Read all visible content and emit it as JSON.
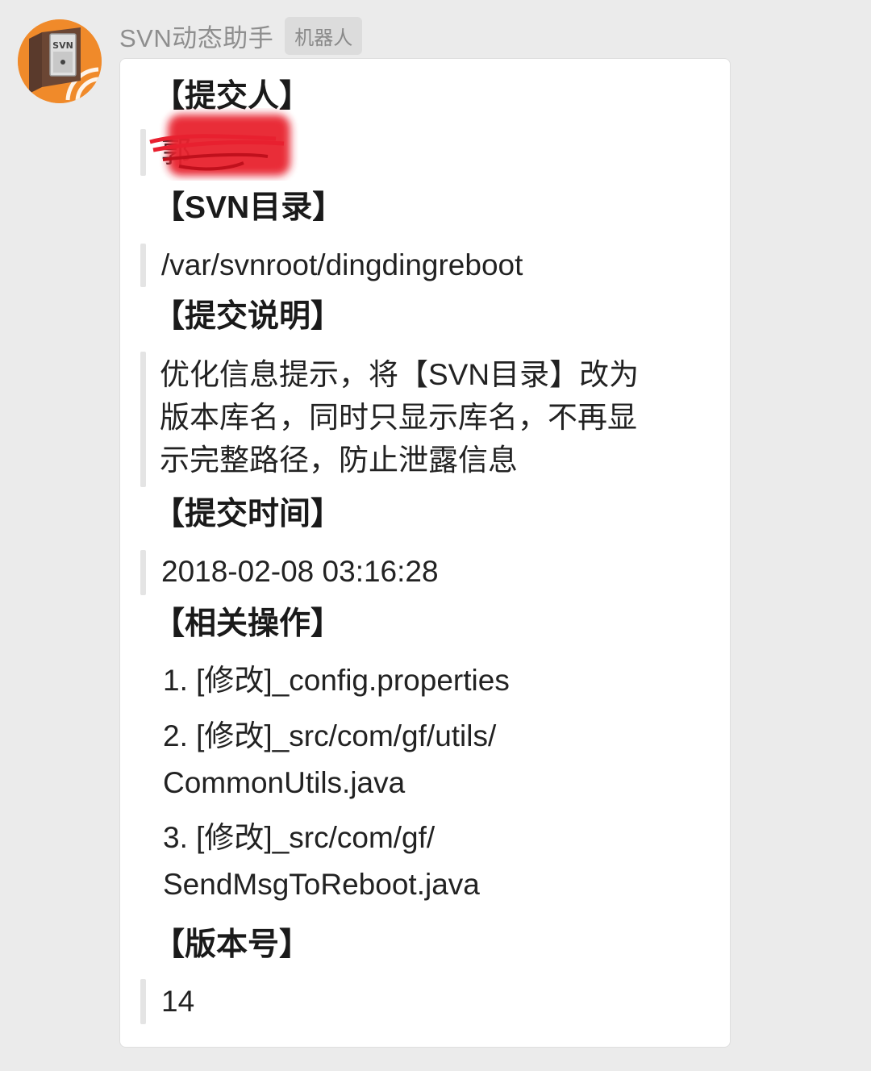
{
  "sender": {
    "name": "SVN动态助手",
    "badge": "机器人",
    "avatar_icon": "svn-box-icon"
  },
  "message": {
    "committer": {
      "heading": "【提交人】",
      "value": "郭"
    },
    "svn_dir": {
      "heading": "【SVN目录】",
      "value": "/var/svnroot/dingdingreboot"
    },
    "commit_desc": {
      "heading": "【提交说明】",
      "lines": [
        "优化信息提示，将【SVN目录】改为",
        "版本库名，同时只显示库名，不再显",
        "示完整路径，防止泄露信息"
      ]
    },
    "commit_time": {
      "heading": "【提交时间】",
      "value": "2018-02-08 03:16:28"
    },
    "operations": {
      "heading": "【相关操作】",
      "items": [
        {
          "lines": [
            "1. [修改]_config.properties"
          ]
        },
        {
          "lines": [
            "2. [修改]_src/com/gf/utils/",
            "CommonUtils.java"
          ]
        },
        {
          "lines": [
            "3. [修改]_src/com/gf/",
            "SendMsgToReboot.java"
          ]
        }
      ]
    },
    "version": {
      "heading": "【版本号】",
      "value": "14"
    }
  },
  "colors": {
    "background": "#ebebeb",
    "bubble": "#ffffff",
    "avatar": "#f08a2a",
    "redaction": "#e8202f"
  }
}
